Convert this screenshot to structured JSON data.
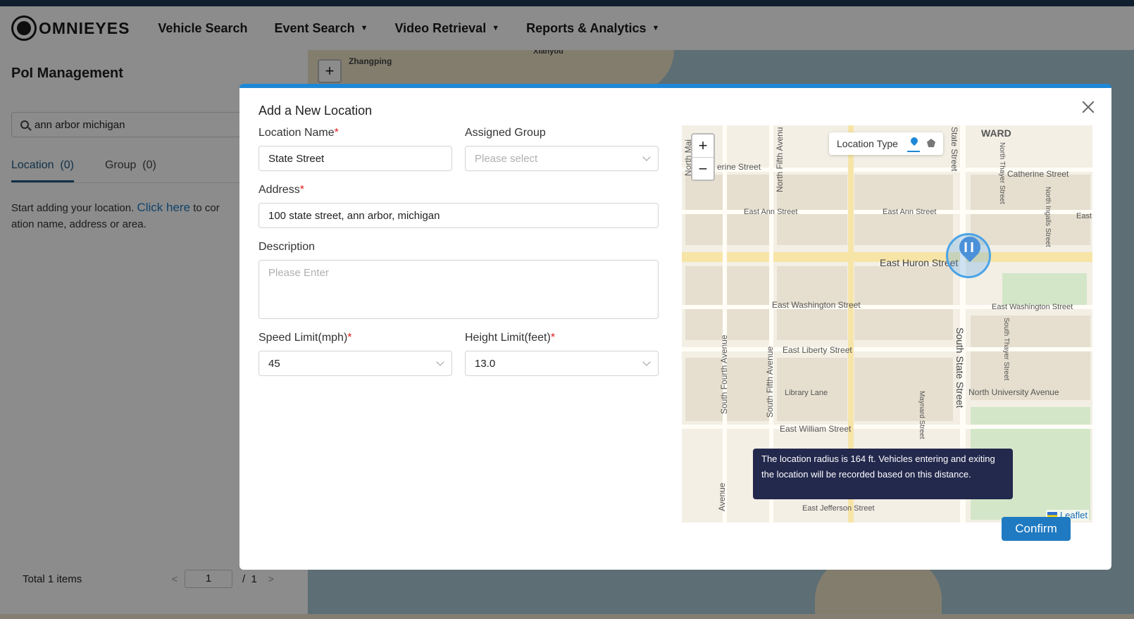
{
  "app": {
    "logo_text": "OMNIEYES",
    "nav": [
      {
        "label": "Vehicle Search"
      },
      {
        "label": "Event Search"
      },
      {
        "label": "Video Retrieval"
      },
      {
        "label": "Reports & Analytics"
      }
    ]
  },
  "sidebar": {
    "title": "PoI Management",
    "search_value": "ann arbor michigan",
    "tabs": [
      {
        "label": "Location  (0)"
      },
      {
        "label": "Group  (0)"
      }
    ],
    "hint_before": "Start adding your location. ",
    "hint_link": "Click here",
    "hint_after": " to cor ation name, address or area.",
    "total": "Total 1 items",
    "page_current": "1",
    "page_total": "/  1"
  },
  "background_map": {
    "cities": [
      "Zhangping",
      "Xianyou"
    ]
  },
  "modal": {
    "title": "Add a New Location",
    "location_name": {
      "label": "Location Name",
      "value": "State Street"
    },
    "assigned_group": {
      "label": "Assigned Group",
      "placeholder": "Please select"
    },
    "address": {
      "label": "Address",
      "value": "100 state street, ann arbor, michigan"
    },
    "description": {
      "label": "Description",
      "placeholder": "Please Enter"
    },
    "speed_limit": {
      "label": "Speed Limit(mph)",
      "value": "45"
    },
    "height_limit": {
      "label": "Height Limit(feet)",
      "value": "13.0"
    },
    "required_mark": "*",
    "confirm_label": "Confirm"
  },
  "map": {
    "location_type_label": "Location Type",
    "ward_label": "WARD",
    "streets": {
      "catherine_w": "erine Street",
      "catherine_e": "Catherine Street",
      "ann_w": "East Ann Street",
      "ann_e": "East Ann Street",
      "east_edge": "East",
      "huron": "East Huron Street",
      "washington_w": "East Washington Street",
      "washington_e": "East Washington Street",
      "liberty": "East Liberty Street",
      "library": "Library Lane",
      "university": "North University Avenue",
      "william": "East William Street",
      "jefferson": "East Jefferson Street",
      "north_main": "North Mai",
      "north_fifth": "North Fifth Avenu",
      "north_state": "State Street",
      "north_thayer": "North Thayer Street",
      "north_ingalls": "North Ingalls Street",
      "south_fourth": "South Fourth Avenue",
      "south_fifth": "South Fifth Avenue",
      "south_state": "South State Street",
      "south_thayer": "South Thayer Street",
      "maynard": "Maynard Street",
      "avenue_bottom": "Avenue"
    },
    "radius_tooltip": "The location radius is 164 ft. Vehicles entering and exiting the location will be recorded based on this distance.",
    "attribution": "Leaflet"
  }
}
